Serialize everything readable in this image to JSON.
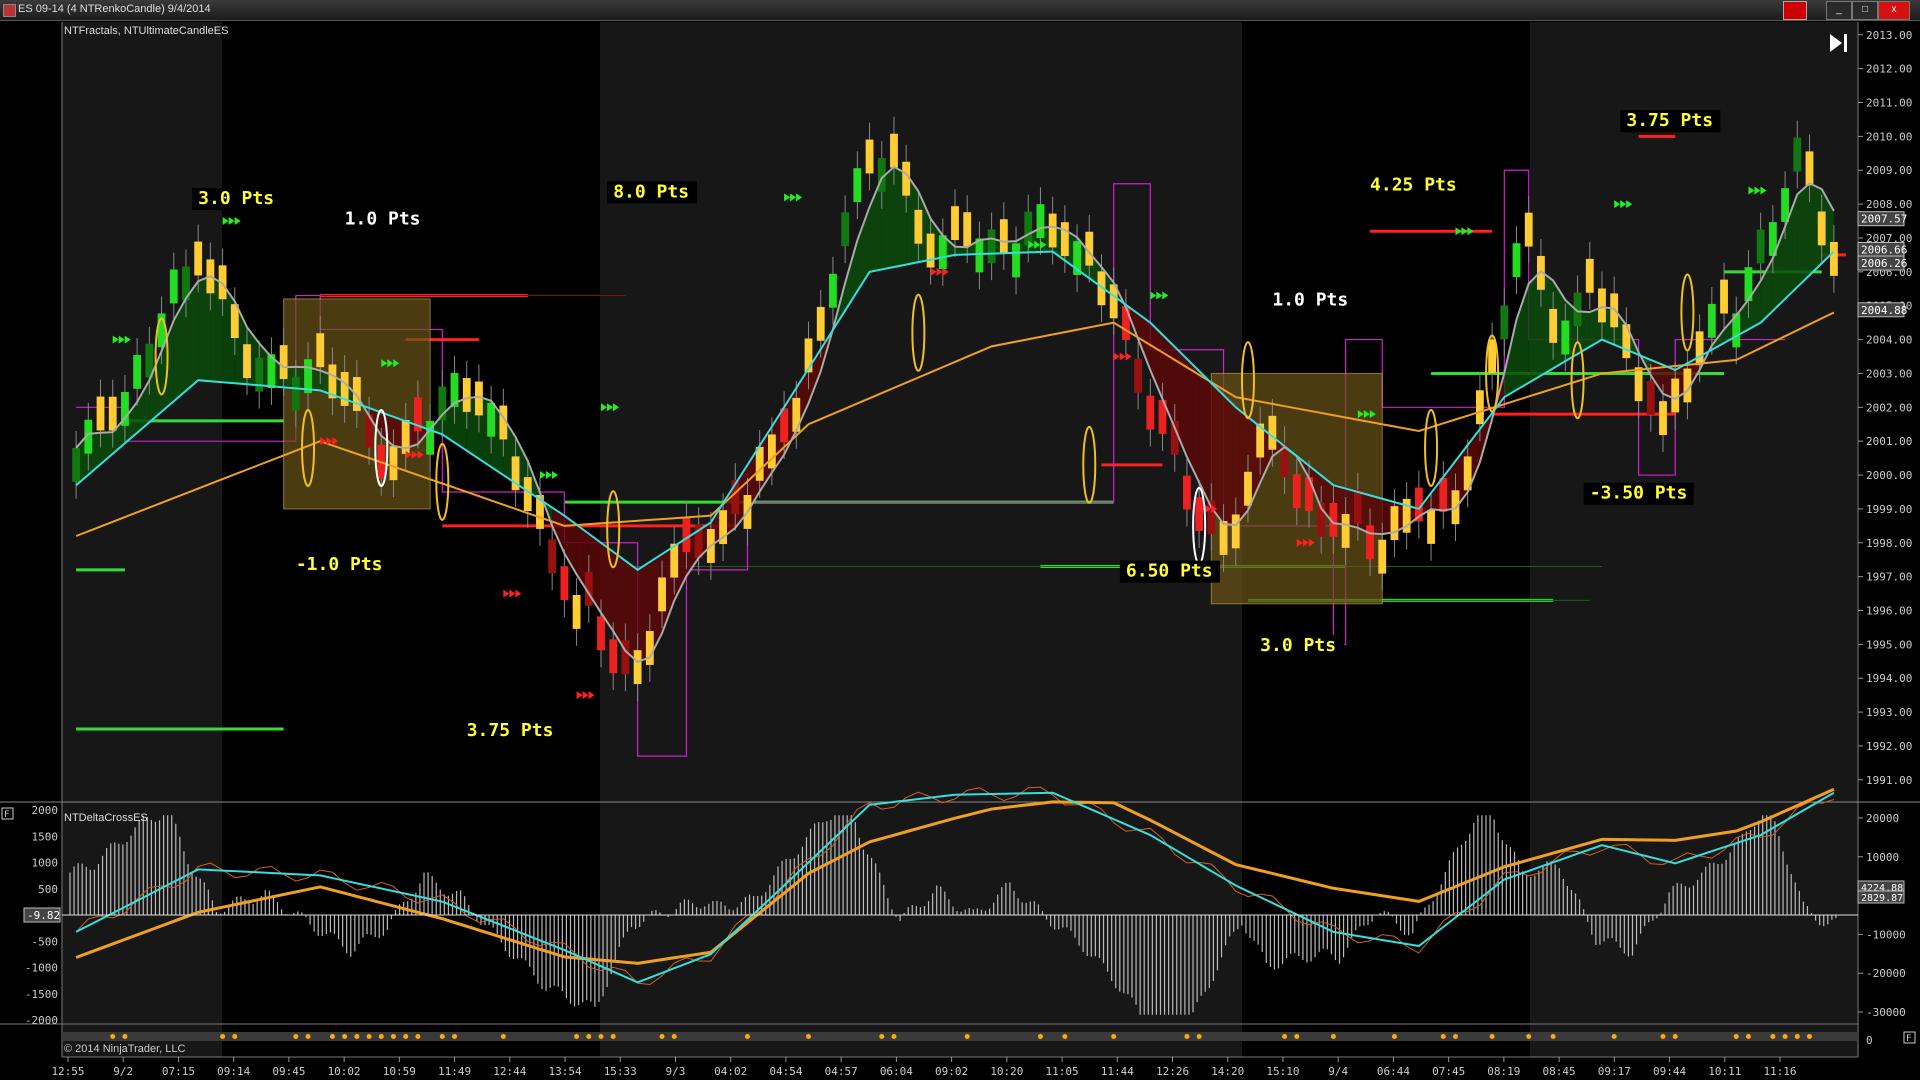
{
  "window": {
    "title": "ES 09-14 (4 NTRenkoCandle)  9/4/2014",
    "buttons": [
      "_",
      "□",
      "x"
    ]
  },
  "price_panel": {
    "indicator_label": "NTFractals, NTUltimateCandleES",
    "y_ticks": [
      "2013.00",
      "2012.00",
      "2011.00",
      "2010.00",
      "2009.00",
      "2008.00",
      "2007.00",
      "2006.00",
      "2005.00",
      "2004.00",
      "2003.00",
      "2002.00",
      "2001.00",
      "2000.00",
      "1999.00",
      "1998.00",
      "1997.00",
      "1996.00",
      "1995.00",
      "1994.00",
      "1993.00",
      "1992.00",
      "1991.00"
    ],
    "price_markers": [
      "2007.57",
      "2006.66",
      "2006.26",
      "2004.88"
    ],
    "annotations": [
      {
        "text": "3.0  Pts",
        "color": "#ffff33",
        "price": 2008.0,
        "bar": 10
      },
      {
        "text": "1.0  Pts",
        "color": "#ffffff",
        "price": 2007.4,
        "bar": 22
      },
      {
        "text": "8.0  Pts",
        "color": "#ffff33",
        "price": 2008.2,
        "bar": 44
      },
      {
        "text": "-1.0  Pts",
        "color": "#ffff33",
        "price": 1997.2,
        "bar": 18
      },
      {
        "text": "3.75  Pts",
        "color": "#ffff33",
        "price": 1992.3,
        "bar": 32
      },
      {
        "text": "6.50  Pts",
        "color": "#ffff33",
        "price": 1997.0,
        "bar": 86
      },
      {
        "text": "1.0  Pts",
        "color": "#ffffff",
        "price": 2005.0,
        "bar": 98
      },
      {
        "text": "4.25  Pts",
        "color": "#ffff33",
        "price": 2008.4,
        "bar": 106
      },
      {
        "text": "3.0  Pts",
        "color": "#ffff33",
        "price": 1994.8,
        "bar": 97
      },
      {
        "text": "3.75  Pts",
        "color": "#ffff33",
        "price": 2010.3,
        "bar": 127
      },
      {
        "text": "-3.50  Pts",
        "color": "#ffff33",
        "price": 1999.3,
        "bar": 124
      }
    ],
    "nav_button": "end-icon"
  },
  "lower_panel": {
    "indicator_label": "NTDeltaCrossES",
    "left_ticks": [
      "2000",
      "1500",
      "1000",
      "500",
      "0",
      "-500",
      "-1000",
      "-1500",
      "-2000"
    ],
    "right_ticks": [
      "20000",
      "10000",
      "0",
      "-10000",
      "-20000",
      "-30000"
    ],
    "left_marker": "-9.82",
    "right_markers": [
      "4224.88",
      "2829.87"
    ],
    "bottom_right_tick": "0",
    "copyright": "© 2014 NinjaTrader, LLC",
    "float_box": "F"
  },
  "x_axis": {
    "labels": [
      "12:55",
      "9/2",
      "07:15",
      "09:14",
      "09:45",
      "10:02",
      "10:59",
      "11:49",
      "12:44",
      "13:54",
      "15:33",
      "9/3",
      "04:02",
      "04:54",
      "04:57",
      "06:04",
      "09:02",
      "10:20",
      "11:05",
      "11:44",
      "12:26",
      "14:20",
      "15:10",
      "9/4",
      "06:44",
      "07:45",
      "08:19",
      "08:45",
      "09:17",
      "09:44",
      "10:11",
      "11:16"
    ]
  },
  "chart_data": {
    "type": "candlestick",
    "instrument": "ES 09-14",
    "bar_type": "4 NTRenkoCandle",
    "y_range": [
      1990.7,
      2013.2
    ],
    "close_path": [
      [
        0,
        2000.5
      ],
      [
        4,
        2002.5
      ],
      [
        8,
        2005.5
      ],
      [
        10,
        2006.6
      ],
      [
        14,
        2003.0
      ],
      [
        18,
        2003.5
      ],
      [
        22,
        2002.0
      ],
      [
        25,
        2000.6
      ],
      [
        28,
        2001.2
      ],
      [
        31,
        2003.0
      ],
      [
        34,
        2001.5
      ],
      [
        37,
        1999.0
      ],
      [
        41,
        1996.0
      ],
      [
        45,
        1994.0
      ],
      [
        48,
        1996.8
      ],
      [
        52,
        1998.5
      ],
      [
        55,
        1999.5
      ],
      [
        58,
        2001.5
      ],
      [
        61,
        2005.0
      ],
      [
        64,
        2008.5
      ],
      [
        66,
        2010.0
      ],
      [
        68,
        2008.0
      ],
      [
        70,
        2006.0
      ],
      [
        73,
        2007.5
      ],
      [
        76,
        2006.5
      ],
      [
        79,
        2007.8
      ],
      [
        82,
        2006.5
      ],
      [
        85,
        2004.5
      ],
      [
        88,
        2002.0
      ],
      [
        91,
        1999.0
      ],
      [
        93,
        1998.0
      ],
      [
        95,
        1999.5
      ],
      [
        98,
        2001.5
      ],
      [
        100,
        1999.0
      ],
      [
        103,
        1998.5
      ],
      [
        106,
        1997.8
      ],
      [
        109,
        1999.5
      ],
      [
        112,
        1998.2
      ],
      [
        115,
        2002.5
      ],
      [
        118,
        2006.8
      ],
      [
        121,
        2004.5
      ],
      [
        124,
        2005.5
      ],
      [
        127,
        2003.0
      ],
      [
        130,
        2002.0
      ],
      [
        133,
        2004.0
      ],
      [
        136,
        2005.5
      ],
      [
        139,
        2007.5
      ],
      [
        141,
        2009.5
      ],
      [
        143,
        2007.5
      ],
      [
        144,
        2006.2
      ]
    ],
    "ema_slow_path": [
      [
        0,
        1998.2
      ],
      [
        20,
        2001.0
      ],
      [
        40,
        1998.5
      ],
      [
        52,
        1998.8
      ],
      [
        60,
        2001.5
      ],
      [
        75,
        2003.8
      ],
      [
        85,
        2004.5
      ],
      [
        95,
        2002.3
      ],
      [
        110,
        2001.3
      ],
      [
        125,
        2003.0
      ],
      [
        136,
        2003.4
      ],
      [
        144,
        2004.8
      ]
    ],
    "ema_fast_path": [
      [
        0,
        1999.7
      ],
      [
        10,
        2002.8
      ],
      [
        20,
        2002.5
      ],
      [
        30,
        2001.2
      ],
      [
        40,
        1998.8
      ],
      [
        46,
        1997.2
      ],
      [
        52,
        1998.6
      ],
      [
        58,
        2002.0
      ],
      [
        65,
        2006.0
      ],
      [
        72,
        2006.5
      ],
      [
        80,
        2006.6
      ],
      [
        88,
        2004.5
      ],
      [
        95,
        2002.0
      ],
      [
        103,
        1999.7
      ],
      [
        110,
        1999.0
      ],
      [
        117,
        2002.3
      ],
      [
        125,
        2004.0
      ],
      [
        131,
        2003.1
      ],
      [
        138,
        2004.5
      ],
      [
        144,
        2006.6
      ]
    ],
    "delta_series": {
      "hist_range": [
        -2000,
        2000
      ],
      "line_range": [
        -30000,
        20000
      ]
    }
  }
}
